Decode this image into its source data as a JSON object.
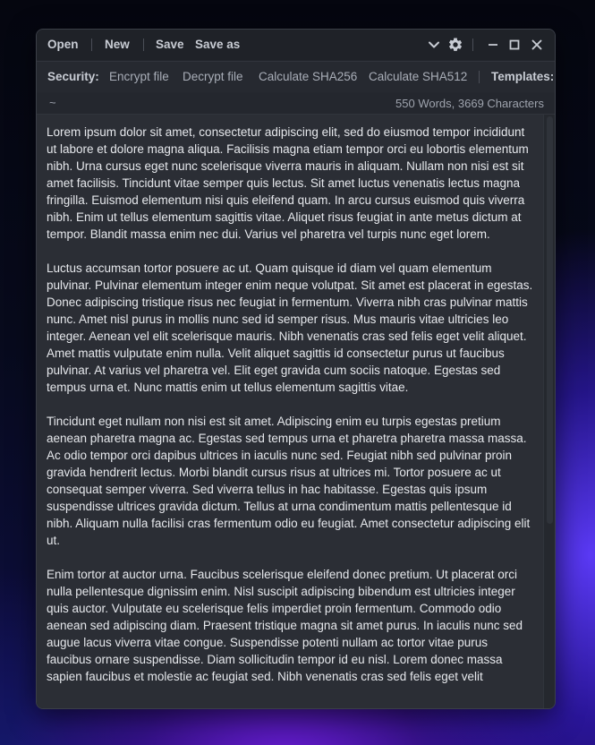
{
  "toolbar": {
    "open_label": "Open",
    "new_label": "New",
    "save_label": "Save",
    "save_as_label": "Save as"
  },
  "security": {
    "label": "Security:",
    "items": [
      "Encrypt file",
      "Decrypt file",
      "Calculate SHA256",
      "Calculate SHA512"
    ],
    "templates_label": "Templates:"
  },
  "status": {
    "path": "~",
    "counts": "550 Words, 3669 Characters"
  },
  "editor": {
    "paragraphs": [
      "Lorem ipsum dolor sit amet, consectetur adipiscing elit, sed do eiusmod tempor incididunt ut labore et dolore magna aliqua. Facilisis magna etiam tempor orci eu lobortis elementum nibh. Urna cursus eget nunc scelerisque viverra mauris in aliquam. Nullam non nisi est sit amet facilisis. Tincidunt vitae semper quis lectus. Sit amet luctus venenatis lectus magna fringilla. Euismod elementum nisi quis eleifend quam. In arcu cursus euismod quis viverra nibh. Enim ut tellus elementum sagittis vitae. Aliquet risus feugiat in ante metus dictum at tempor. Blandit massa enim nec dui. Varius vel pharetra vel turpis nunc eget lorem.",
      "Luctus accumsan tortor posuere ac ut. Quam quisque id diam vel quam elementum pulvinar. Pulvinar elementum integer enim neque volutpat. Sit amet est placerat in egestas. Donec adipiscing tristique risus nec feugiat in fermentum. Viverra nibh cras pulvinar mattis nunc. Amet nisl purus in mollis nunc sed id semper risus. Mus mauris vitae ultricies leo integer. Aenean vel elit scelerisque mauris. Nibh venenatis cras sed felis eget velit aliquet. Amet mattis vulputate enim nulla. Velit aliquet sagittis id consectetur purus ut faucibus pulvinar. At varius vel pharetra vel. Elit eget gravida cum sociis natoque. Egestas sed tempus urna et. Nunc mattis enim ut tellus elementum sagittis vitae.",
      "Tincidunt eget nullam non nisi est sit amet. Adipiscing enim eu turpis egestas pretium aenean pharetra magna ac. Egestas sed tempus urna et pharetra pharetra massa massa. Ac odio tempor orci dapibus ultrices in iaculis nunc sed. Feugiat nibh sed pulvinar proin gravida hendrerit lectus. Morbi blandit cursus risus at ultrices mi. Tortor posuere ac ut consequat semper viverra. Sed viverra tellus in hac habitasse. Egestas quis ipsum suspendisse ultrices gravida dictum. Tellus at urna condimentum mattis pellentesque id nibh. Aliquam nulla facilisi cras fermentum odio eu feugiat. Amet consectetur adipiscing elit ut.",
      "Enim tortor at auctor urna. Faucibus scelerisque eleifend donec pretium. Ut placerat orci nulla pellentesque dignissim enim. Nisl suscipit adipiscing bibendum est ultricies integer quis auctor. Vulputate eu scelerisque felis imperdiet proin fermentum. Commodo odio aenean sed adipiscing diam. Praesent tristique magna sit amet purus. In iaculis nunc sed augue lacus viverra vitae congue. Suspendisse potenti nullam ac tortor vitae purus faucibus ornare suspendisse. Diam sollicitudin tempor id eu nisl. Lorem donec massa sapien faucibus et molestie ac feugiat sed. Nibh venenatis cras sed felis eget velit"
    ]
  },
  "icons": {
    "dropdown": "chevron-down-icon",
    "settings": "gear-icon",
    "minimize": "minimize-icon",
    "maximize": "maximize-icon",
    "close": "close-icon"
  }
}
